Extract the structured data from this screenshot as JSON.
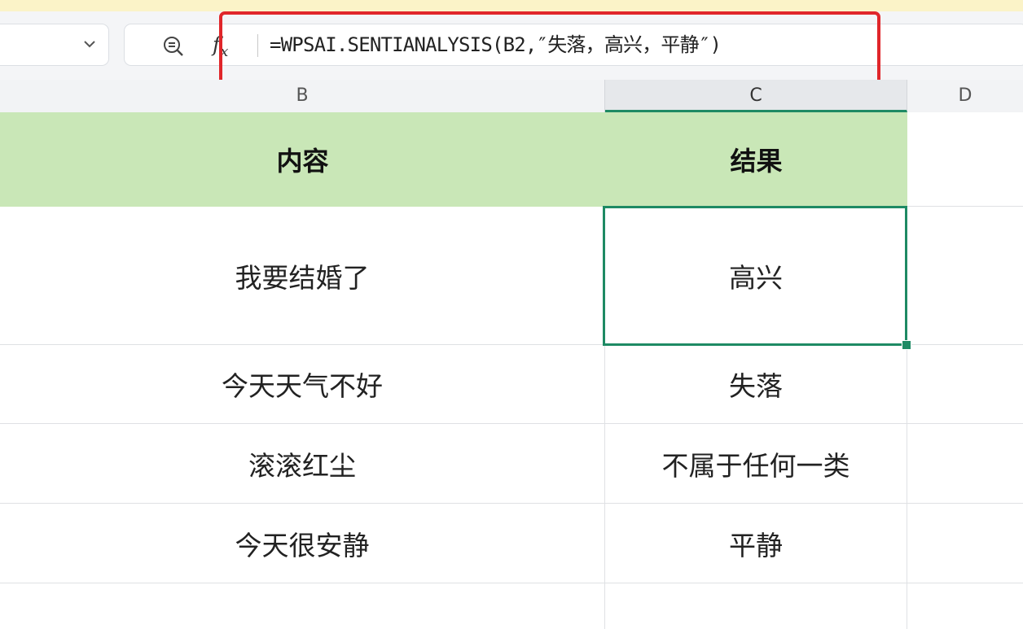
{
  "formula_bar": {
    "icons": {
      "zoom": "zoom-formula-icon",
      "fx": "fx-icon",
      "dropdown": "chevron-down-icon"
    },
    "fx_label": "f",
    "fx_sub": "x",
    "formula": "=WPSAI.SENTIANALYSIS(B2,″失落，高兴，平静″)"
  },
  "columns": [
    "B",
    "C",
    "D"
  ],
  "active_column": "C",
  "table": {
    "headers": [
      "内容",
      "结果"
    ],
    "rows": [
      [
        "我要结婚了",
        "高兴"
      ],
      [
        "今天天气不好",
        "失落"
      ],
      [
        "滚滚红尘",
        "不属于任何一类"
      ],
      [
        "今天很安静",
        "平静"
      ],
      [
        "",
        ""
      ]
    ]
  },
  "colors": {
    "header_fill": "#c9e7b7",
    "selection": "#1e8a64",
    "highlight": "#e0262a"
  }
}
